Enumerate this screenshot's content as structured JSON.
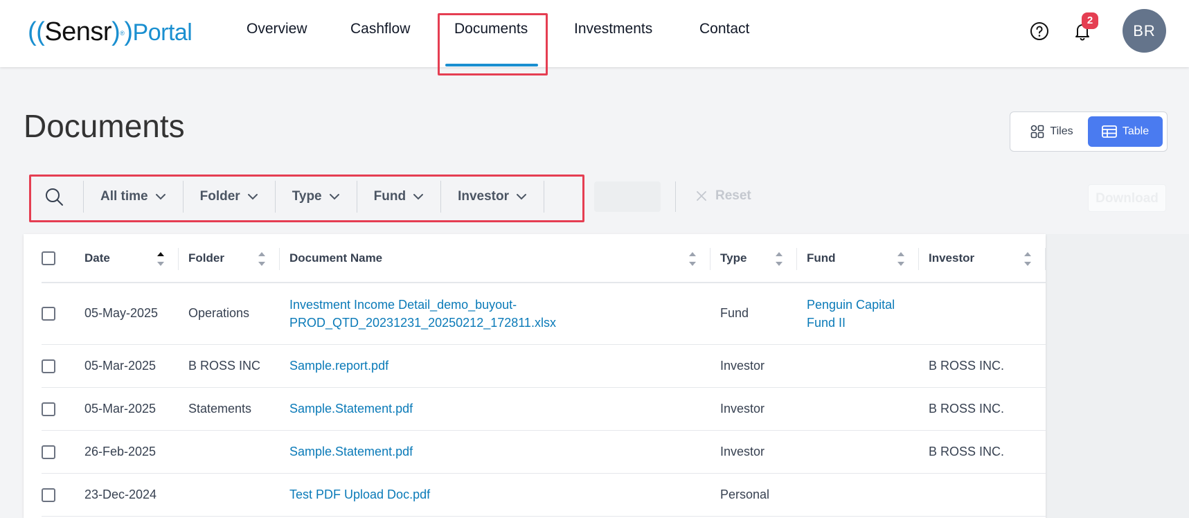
{
  "app": {
    "logo": {
      "brand": "Sensr",
      "portal": "Portal",
      "trademark": "®"
    },
    "colors": {
      "accent": "#1a8fd0",
      "primary_button": "#4a7bf0",
      "highlight": "#e53e52",
      "link": "#0a7ab8"
    }
  },
  "nav": {
    "items": [
      {
        "label": "Overview"
      },
      {
        "label": "Cashflow"
      },
      {
        "label": "Documents",
        "active": true
      },
      {
        "label": "Investments"
      },
      {
        "label": "Contact"
      }
    ]
  },
  "header": {
    "help_icon": "question-circle-icon",
    "notifications": {
      "icon": "bell-icon",
      "count": "2"
    },
    "avatar_initials": "BR"
  },
  "page": {
    "title": "Documents",
    "view_toggle": {
      "tiles_label": "Tiles",
      "table_label": "Table",
      "selected": "Table"
    }
  },
  "filters": {
    "search_icon": "search-icon",
    "items": [
      {
        "label": "All time"
      },
      {
        "label": "Folder"
      },
      {
        "label": "Type"
      },
      {
        "label": "Fund"
      },
      {
        "label": "Investor"
      }
    ],
    "reset_label": "Reset",
    "download_label": "Download"
  },
  "table": {
    "columns": [
      "Date",
      "Folder",
      "Document Name",
      "Type",
      "Fund",
      "Investor"
    ],
    "sorted_column": "Date",
    "rows": [
      {
        "date": "05-May-2025",
        "folder": "Operations",
        "name_line1": "Investment Income Detail_demo_buyout-",
        "name_line2": "PROD_QTD_20231231_20250212_172811.xlsx",
        "type": "Fund",
        "fund_line1": "Penguin Capital",
        "fund_line2": "Fund II",
        "investor": ""
      },
      {
        "date": "05-Mar-2025",
        "folder": "B ROSS INC",
        "name_line1": "Sample.report.pdf",
        "name_line2": "",
        "type": "Investor",
        "fund_line1": "",
        "fund_line2": "",
        "investor": "B ROSS INC."
      },
      {
        "date": "05-Mar-2025",
        "folder": "Statements",
        "name_line1": "Sample.Statement.pdf",
        "name_line2": "",
        "type": "Investor",
        "fund_line1": "",
        "fund_line2": "",
        "investor": "B ROSS INC."
      },
      {
        "date": "26-Feb-2025",
        "folder": "",
        "name_line1": "Sample.Statement.pdf",
        "name_line2": "",
        "type": "Investor",
        "fund_line1": "",
        "fund_line2": "",
        "investor": "B ROSS INC."
      },
      {
        "date": "23-Dec-2024",
        "folder": "",
        "name_line1": "Test PDF Upload Doc.pdf",
        "name_line2": "",
        "type": "Personal",
        "fund_line1": "",
        "fund_line2": "",
        "investor": ""
      }
    ]
  }
}
